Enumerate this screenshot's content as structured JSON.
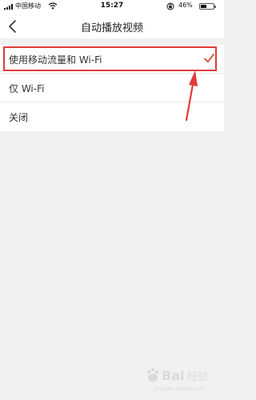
{
  "status_bar": {
    "carrier": "中国移动",
    "time": "15:27",
    "battery": "46%"
  },
  "nav": {
    "title": "自动播放视频",
    "back_icon": "chevron-left-icon"
  },
  "options": [
    {
      "label": "使用移动流量和 Wi-Fi",
      "selected": true
    },
    {
      "label": "仅 Wi-Fi",
      "selected": false
    },
    {
      "label": "关闭",
      "selected": false
    }
  ],
  "colors": {
    "accent": "#d84a2e",
    "annotation": "#e23a3a",
    "background": "#f1f1f1"
  },
  "watermark": {
    "text": "Baidu 经验",
    "url": "jingyan.baidu.com"
  }
}
